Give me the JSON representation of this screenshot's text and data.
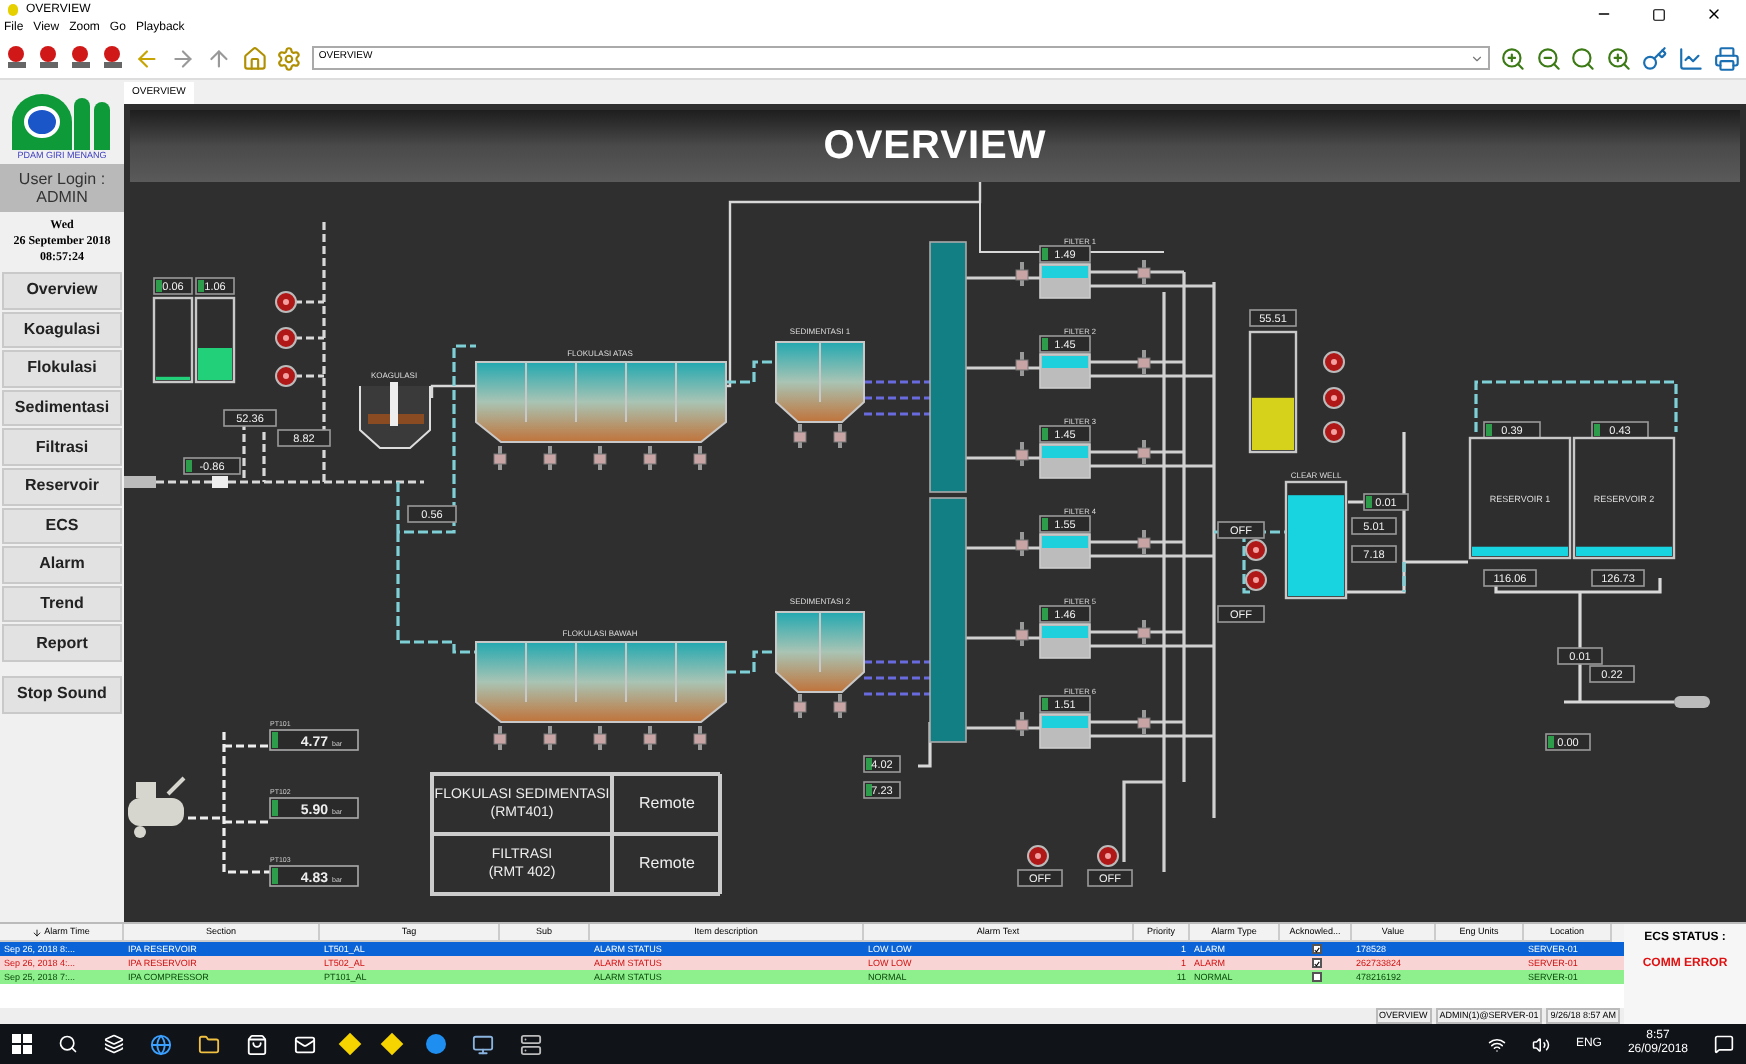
{
  "window": {
    "title": "OVERVIEW"
  },
  "menu": [
    "File",
    "View",
    "Zoom",
    "Go",
    "Playback"
  ],
  "toolbar": {
    "address": "OVERVIEW"
  },
  "tabs": [
    {
      "label": "OVERVIEW",
      "selected": true
    }
  ],
  "sidebar": {
    "logo_text": "PDAM GIRI MENANG",
    "user_login": [
      "User Login :",
      "ADMIN"
    ],
    "date": [
      "Wed",
      "26 September 2018",
      "08:57:24"
    ],
    "nav": [
      "Overview",
      "Koagulasi",
      "Flokulasi",
      "Sedimentasi",
      "Filtrasi",
      "Reservoir",
      "ECS",
      "Alarm",
      "Trend",
      "Report"
    ],
    "stop_sound": "Stop Sound"
  },
  "header": "OVERVIEW",
  "diagram": {
    "chemical_tanks": [
      {
        "value": "0.06",
        "level": 0.04
      },
      {
        "value": "1.06",
        "level": 0.4
      }
    ],
    "dosing_readouts": [
      "52.36",
      "8.82",
      "-0.86",
      "0.56"
    ],
    "labels": {
      "koagulasi": "KOAGULASI",
      "flok_top": "FLOKULASI ATAS",
      "flok_bottom": "FLOKULASI BAWAH",
      "sed_1": "SEDIMENTASI 1",
      "sed_2": "SEDIMENTASI 2",
      "clear_well": "CLEAR WELL",
      "reservoir_1": "RESERVOIR 1",
      "reservoir_2": "RESERVOIR 2"
    },
    "filters": [
      {
        "name": "FILTER 1",
        "value": "1.49"
      },
      {
        "name": "FILTER 2",
        "value": "1.45"
      },
      {
        "name": "FILTER 3",
        "value": "1.45"
      },
      {
        "name": "FILTER 4",
        "value": "1.55"
      },
      {
        "name": "FILTER 5",
        "value": "1.46"
      },
      {
        "name": "FILTER 6",
        "value": "1.51"
      }
    ],
    "backwash_pumps": [
      "OFF",
      "OFF"
    ],
    "transfer_pumps": [
      "OFF",
      "OFF"
    ],
    "chlorine_tank": {
      "value": "55.51",
      "level": 0.45
    },
    "clear_well": {
      "level": 0.9,
      "readouts": [
        "0.01",
        "5.01",
        "7.18"
      ]
    },
    "sed_readouts": [
      "4.02",
      "7.23"
    ],
    "reservoirs": [
      {
        "value": "0.39",
        "level": 0.08,
        "flow": "116.06"
      },
      {
        "value": "0.43",
        "level": 0.08,
        "flow": "126.73"
      }
    ],
    "outlet_readouts": [
      "0.01",
      "0.22",
      "0.00"
    ],
    "compressor": [
      {
        "tag": "PT101",
        "value": "4.77",
        "unit": "bar"
      },
      {
        "tag": "PT102",
        "value": "5.90",
        "unit": "bar"
      },
      {
        "tag": "PT103",
        "value": "4.83",
        "unit": "bar"
      }
    ],
    "mode_table": [
      {
        "section": "FLOKULASI SEDIMENTASI",
        "code": "(RMT401)",
        "mode": "Remote"
      },
      {
        "section": "FILTRASI",
        "code": "(RMT 402)",
        "mode": "Remote"
      }
    ]
  },
  "alarms": {
    "columns": [
      "Alarm Time",
      "Section",
      "Tag",
      "Sub",
      "Item description",
      "Alarm Text",
      "Priority",
      "Alarm Type",
      "Acknowled...",
      "Value",
      "Eng Units",
      "Location"
    ],
    "rows": [
      {
        "kind": "alarm",
        "selected": true,
        "time": "Sep 26, 2018 8:...",
        "section": "IPA RESERVOIR",
        "tag": "LT501_AL",
        "item": "ALARM STATUS",
        "text": "LOW LOW",
        "priority": "1",
        "type": "ALARM",
        "acknowledged": true,
        "value": "178528",
        "location": "SERVER-01"
      },
      {
        "kind": "alarm",
        "selected": false,
        "time": "Sep 26, 2018 4:...",
        "section": "IPA RESERVOIR",
        "tag": "LT502_AL",
        "item": "ALARM STATUS",
        "text": "LOW LOW",
        "priority": "1",
        "type": "ALARM",
        "acknowledged": true,
        "value": "262733824",
        "location": "SERVER-01"
      },
      {
        "kind": "normal",
        "selected": false,
        "time": "Sep 25, 2018 7:...",
        "section": "IPA COMPRESSOR",
        "tag": "PT101_AL",
        "item": "ALARM STATUS",
        "text": "NORMAL",
        "priority": "11",
        "type": "NORMAL",
        "acknowledged": false,
        "value": "478216192",
        "location": "SERVER-01"
      }
    ],
    "ecs_label": "ECS STATUS :",
    "ecs_value": "COMM ERROR"
  },
  "status_bar": [
    "OVERVIEW",
    "ADMIN(1)@SERVER-01",
    "9/26/18 8:57 AM"
  ],
  "taskbar": {
    "language": "ENG",
    "time": "8:57",
    "date": "26/09/2018"
  }
}
